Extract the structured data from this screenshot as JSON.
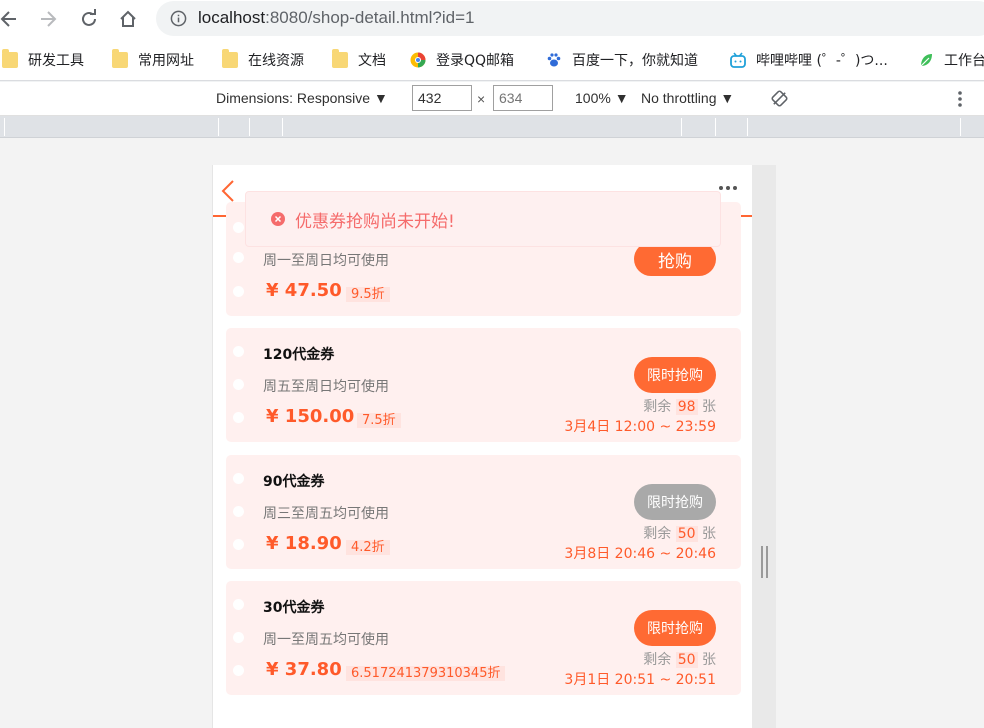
{
  "browser": {
    "url_host": "localhost",
    "url_rest": ":8080/shop-detail.html?id=1"
  },
  "bookmarks": [
    {
      "label": "研发工具",
      "icon": "folder-icon"
    },
    {
      "label": "常用网址",
      "icon": "folder-icon"
    },
    {
      "label": "在线资源",
      "icon": "folder-icon"
    },
    {
      "label": "文档",
      "icon": "folder-icon"
    },
    {
      "label": "登录QQ邮箱",
      "icon": "qq-mail-icon"
    },
    {
      "label": "百度一下，你就知道",
      "icon": "baidu-paw-icon"
    },
    {
      "label": "哔哩哔哩 (゜-゜)つ...",
      "icon": "bilibili-icon"
    },
    {
      "label": "工作台",
      "icon": "leaf-icon"
    }
  ],
  "devtools": {
    "dimensions_label": "Dimensions: Responsive ▼",
    "width": "432",
    "height_placeholder": "634",
    "times": "×",
    "zoom_label": "100% ▼",
    "throttle_label": "No throttling ▼"
  },
  "toast": {
    "message": "优惠券抢购尚未开始!",
    "icon": "error-circle-icon"
  },
  "coupons": [
    {
      "desc": "周一至周日均可使用",
      "price": "¥ 47.50",
      "discount": "9.5折",
      "button": "抢购"
    },
    {
      "title": "120代金券",
      "desc": "周五至周日均可使用",
      "price": "¥ 150.00",
      "discount": "7.5折",
      "button": "限时抢购",
      "remain_prefix": "剩余",
      "remain_count": "98",
      "remain_suffix": "张",
      "time": "3月4日 12:00 ~ 23:59"
    },
    {
      "title": "90代金券",
      "desc": "周三至周五均可使用",
      "price": "¥ 18.90",
      "discount": "4.2折",
      "button": "限时抢购",
      "remain_prefix": "剩余",
      "remain_count": "50",
      "remain_suffix": "张",
      "time": "3月8日 20:46 ~ 20:46"
    },
    {
      "title": "30代金券",
      "desc": "周一至周五均可使用",
      "price": "¥ 37.80",
      "discount": "6.517241379310345折",
      "button": "限时抢购",
      "remain_prefix": "剩余",
      "remain_count": "50",
      "remain_suffix": "张",
      "time": "3月1日 20:51 ~ 20:51"
    }
  ],
  "colors": {
    "accent": "#ff6633",
    "card_bg": "#fff0ef",
    "disabled_button": "#a9a9a9",
    "toast_text": "#f56c6c"
  }
}
